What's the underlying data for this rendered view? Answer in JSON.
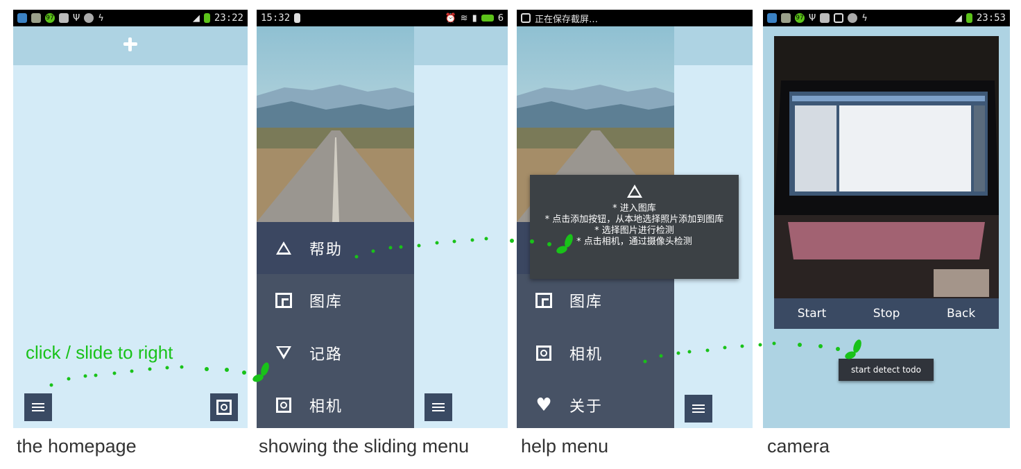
{
  "phones": {
    "home": {
      "status_time": "23:22",
      "status_badge": "97",
      "hint": "click /  slide to right",
      "caption": "the homepage"
    },
    "menu": {
      "status_time": "15:32",
      "status_right": "6",
      "items": [
        {
          "label": "帮助",
          "icon": "triangle-up-icon"
        },
        {
          "label": "图库",
          "icon": "gallery-icon"
        },
        {
          "label": "记路",
          "icon": "triangle-down-icon"
        },
        {
          "label": "相机",
          "icon": "camera-icon"
        }
      ],
      "caption": "showing the sliding menu"
    },
    "help": {
      "status_text": "正在保存截屏…",
      "items": [
        {
          "label": "图库",
          "icon": "gallery-icon"
        },
        {
          "label": "相机",
          "icon": "camera-icon"
        },
        {
          "label": "关于",
          "icon": "heart-icon"
        }
      ],
      "popup": {
        "lines": [
          "* 进入图库",
          "* 点击添加按钮，从本地选择照片添加到图库",
          "* 选择图片进行检测",
          "* 点击相机，通过摄像头检测"
        ]
      },
      "caption": "help menu"
    },
    "camera": {
      "status_time": "23:53",
      "status_badge": "97",
      "buttons": {
        "start": "Start",
        "stop": "Stop",
        "back": "Back"
      },
      "toast": "start detect todo",
      "caption": "camera"
    }
  },
  "colors": {
    "background_light": "#d4ebf7",
    "topbar": "#aed3e3",
    "button_dark": "#3a4a63",
    "drawer": "#475265",
    "hint_green": "#19c219"
  }
}
